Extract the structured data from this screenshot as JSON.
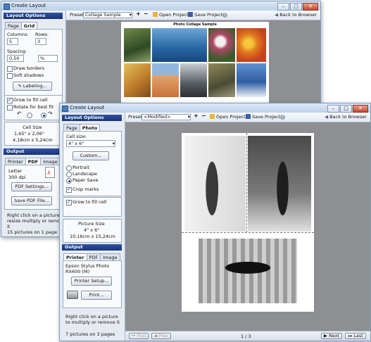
{
  "back_window": {
    "title": "Create Layout",
    "panel": {
      "options_header": "Layout Options",
      "tabs": [
        "Page",
        "Grid"
      ],
      "columns_label": "Columns:",
      "columns_value": "5",
      "rows_label": "Rows:",
      "rows_value": "3",
      "spacing_label": "Spacing:",
      "spacing_value": "0,50",
      "spacing_unit": "%",
      "draw_borders": "Draw borders",
      "soft_shadows": "Soft shadows",
      "labeling_button": "Labeling...",
      "grow_to_fill": "Grow to fill cell",
      "rotate_best_fit": "Rotate for best fit",
      "cell_size_label": "Cell Size",
      "cell_size_in": "1,65\" x 2,06\"",
      "cell_size_cm": "4,18cm x 5,24cm",
      "output_header": "Output",
      "output_tabs": [
        "Printer",
        "PDF",
        "Image"
      ],
      "paper": "Letter",
      "dpi": "300 dpi",
      "pdf_settings_button": "PDF Settings...",
      "save_pdf_button": "Save PDF File...",
      "hint": "Right click on a picture to resize multiply or remove it",
      "status": "15 pictures on 1 page"
    },
    "toolbar": {
      "preset_label": "Preset",
      "preset_value": "Collage Sample",
      "open_project": "Open Project",
      "save_project": "Save Project",
      "back_to_browser": "Back to Browser",
      "help": "?"
    },
    "collage_title": "Photo Collage Sample"
  },
  "front_window": {
    "title": "Create Layout",
    "panel": {
      "options_header": "Layout Options",
      "tabs": [
        "Page",
        "Photo"
      ],
      "cell_size_label": "Cell size:",
      "cell_size_value": "4\" x 6\"",
      "custom_button": "Custom...",
      "orientation": [
        "Portrait",
        "Landscape",
        "Paper Save"
      ],
      "crop_marks": "Crop marks",
      "grow_to_fill": "Grow to fill cell",
      "picture_size_label": "Picture Size",
      "picture_size_in": "4\" x 6\"",
      "picture_size_cm": "10,16cm x 15,24cm",
      "output_header": "Output",
      "output_tabs": [
        "Printer",
        "PDF",
        "Image"
      ],
      "printer_name": "Epson Stylus Photo RX600 (M)",
      "printer_setup_button": "Printer Setup...",
      "print_button": "Print...",
      "hint": "Right click on a picture to multiply or remove it",
      "status": "7 pictures on 3 pages"
    },
    "toolbar": {
      "preset_label": "Preset",
      "preset_value": "<Modified>",
      "open_project": "Open Project",
      "save_project": "Save Project",
      "back_to_browser": "Back to Browser",
      "help": "?"
    },
    "bottom": {
      "first": "First",
      "prev": "Prev",
      "page_indicator": "1 / 3",
      "next": "Next",
      "last": "Last"
    }
  },
  "icon_names": [
    "app-icon",
    "add-icon",
    "remove-icon",
    "open-folder-icon",
    "save-disk-icon",
    "help-icon",
    "back-arrow-icon",
    "pdf-file-icon",
    "printer-icon",
    "rotate-left-icon",
    "rotate-right-icon"
  ],
  "colors": {
    "section_header": "#1b3378",
    "canvas_gray": "#8d8f93",
    "title_bar": "#bcd0ea"
  }
}
